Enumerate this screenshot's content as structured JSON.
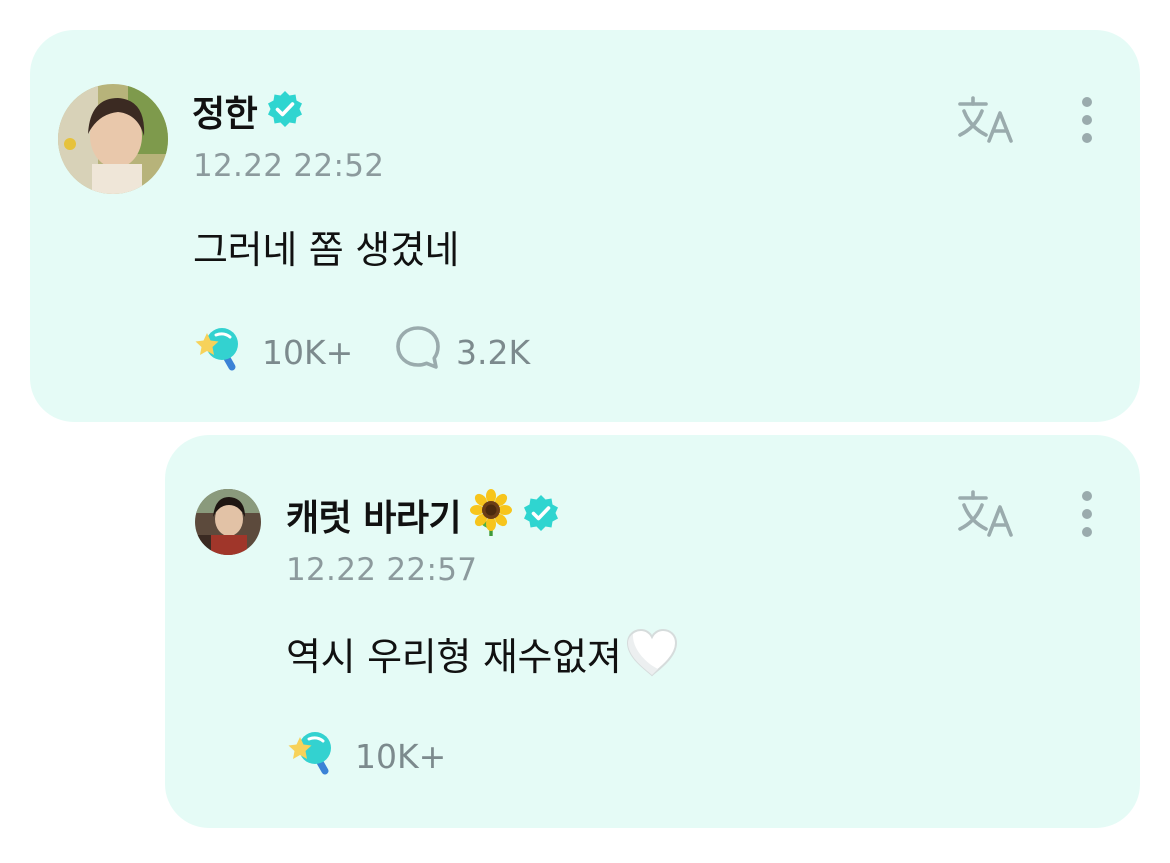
{
  "colors": {
    "card_background": "#e5fbf6",
    "verified_badge": "#2fd5d0",
    "meta_text": "#8c9a9d",
    "icon_gray": "#9aabad"
  },
  "post": {
    "author": "정한",
    "verified": true,
    "timestamp": "12.22 22:52",
    "text": "그러네 쫌 생겼네",
    "like_count": "10K+",
    "comment_count": "3.2K",
    "icons": [
      "translate-icon",
      "more-vertical-icon",
      "light-stick-icon",
      "comment-bubble-icon"
    ]
  },
  "reply": {
    "author": "캐럿 바라기",
    "author_emoji": "🌻",
    "verified": true,
    "timestamp": "12.22 22:57",
    "text": "역시 우리형 재수없져",
    "text_emoji": "🤍",
    "like_count": "10K+",
    "icons": [
      "translate-icon",
      "more-vertical-icon",
      "light-stick-icon"
    ]
  }
}
